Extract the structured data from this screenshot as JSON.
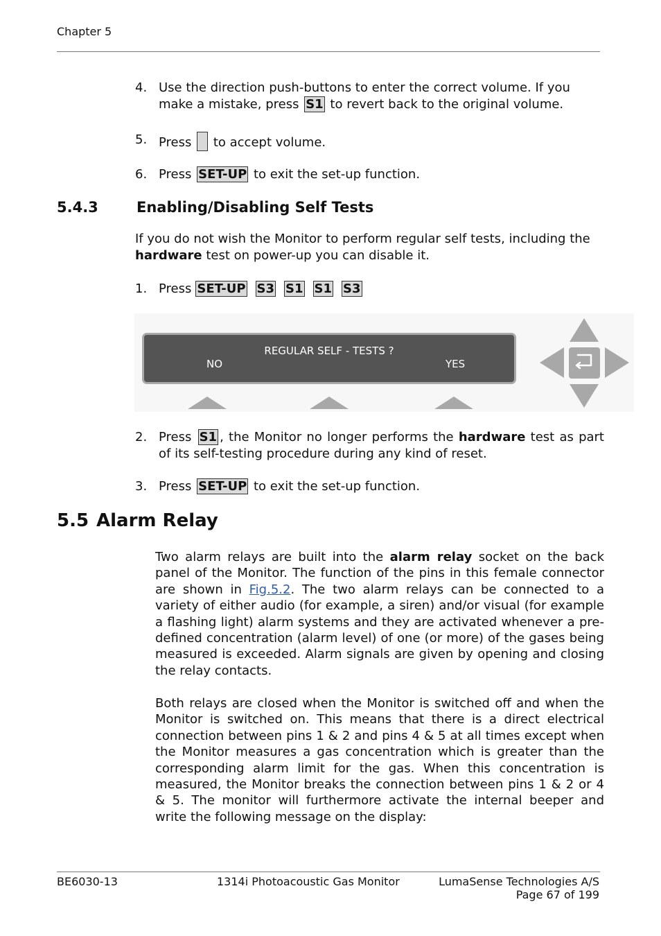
{
  "header": {
    "chapter": "Chapter 5"
  },
  "steps_a": [
    {
      "num": "4.",
      "pre": "Use the direction push-buttons to enter the correct volume. If you make a mistake, press ",
      "key": "S1",
      "post": " to revert back to the original volume."
    },
    {
      "num": "5.",
      "pre": "Press ",
      "key": "",
      "post": " to accept volume."
    },
    {
      "num": "6.",
      "pre": "Press ",
      "key": "SET-UP",
      "post": " to exit the set-up function."
    }
  ],
  "section_543": {
    "number": "5.4.3",
    "title": "Enabling/Disabling Self Tests",
    "intro_pre": "If you do not wish the Monitor to perform regular self tests, including the ",
    "intro_bold": "hardware",
    "intro_post": " test on power-up you can disable it.",
    "step1": {
      "num": "1.",
      "pre": "Press",
      "keys": [
        "SET-UP",
        "S3",
        "S1",
        "S1",
        "S3"
      ]
    },
    "display": {
      "line1": "REGULAR SELF - TESTS  ?",
      "left_option": "NO",
      "right_option": "YES"
    },
    "step2": {
      "num": "2.",
      "pre": "Press ",
      "key": "S1",
      "mid": ", the Monitor no longer performs the ",
      "bold": "hardware",
      "post": " test as part of its self-testing procedure during any kind of reset."
    },
    "step3": {
      "num": "3.",
      "pre": "Press ",
      "key": "SET-UP",
      "post": " to exit the set-up function."
    }
  },
  "section_55": {
    "number": "5.5",
    "title": "Alarm Relay",
    "para1": {
      "pre": "Two alarm relays are built into the ",
      "bold": "alarm relay",
      "mid": " socket on the back panel of the Monitor. The function of the pins in this female connector are shown in ",
      "link": "Fig.5.2",
      "post": ". The two alarm relays can be connected to a variety of either audio (for example, a siren) and/or visual (for example a flashing light) alarm systems and they are activated whenever a pre-defined concentration (alarm level) of one (or more) of the gases being measured is exceeded. Alarm signals are given by opening and closing the relay contacts."
    },
    "para2": "Both relays are closed when the Monitor is switched off and when the Monitor is switched on. This means that there is a direct electrical connection between pins 1 & 2 and pins 4 & 5 at all times except when the Monitor measures a gas concentration which is greater than the corresponding alarm limit for the gas. When this concentration is measured, the Monitor breaks the connection between pins 1 & 2 or 4 & 5. The monitor will furthermore activate the internal beeper and write the following message on the display:"
  },
  "footer": {
    "doc_id": "BE6030-13",
    "product": "1314i Photoacoustic Gas Monitor",
    "company": "LumaSense Technologies A/S",
    "page": "Page 67 of 199"
  },
  "colors": {
    "lcd_bg": "#545454",
    "key_bg": "#d9d9d9",
    "button_gray": "#a8a8a8",
    "link": "#2f5da9"
  }
}
